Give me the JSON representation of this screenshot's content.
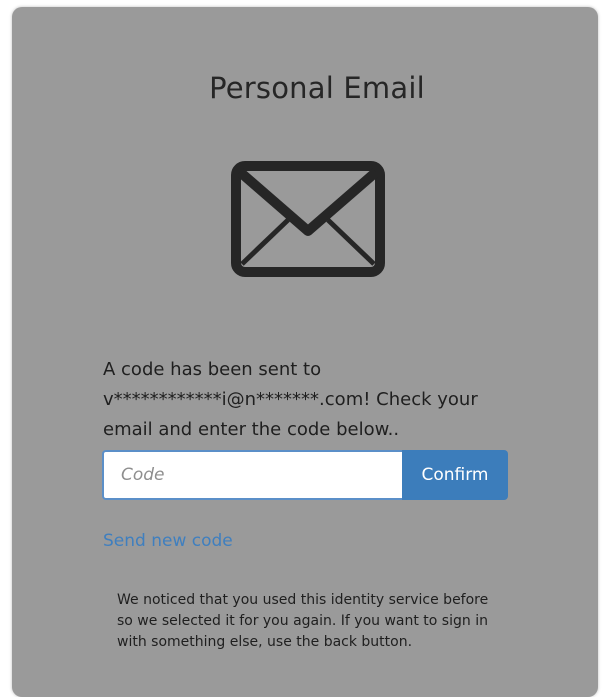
{
  "card": {
    "title": "Personal Email",
    "icon": "envelope-icon",
    "message": "A code has been sent to v************i@n*******.com! Check your email and enter the code below..",
    "code_input": {
      "value": "",
      "placeholder": "Code"
    },
    "confirm_label": "Confirm",
    "send_new_code_label": "Send new code",
    "notice": "We noticed that you used this identity service before so we selected it for you again. If you want to sign in with something else, use the back button."
  },
  "colors": {
    "card_background": "#9a9a9a",
    "accent": "#3c7dbb",
    "link": "#3f7fbf",
    "text": "#262626"
  }
}
